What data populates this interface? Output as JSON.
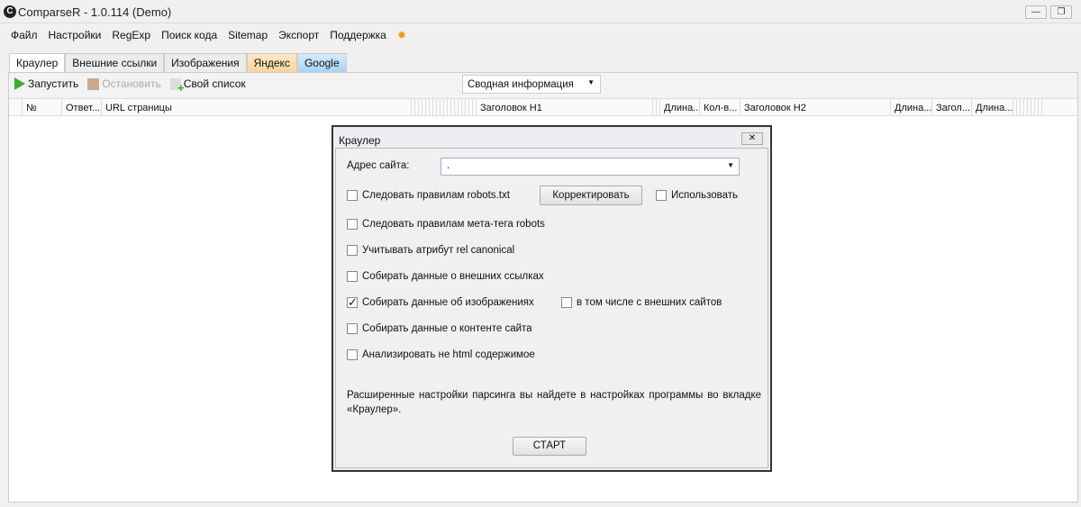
{
  "window": {
    "title": "ComparseR - 1.0.114 (Demo)",
    "logo": "C"
  },
  "menu": [
    "Файл",
    "Настройки",
    "RegExp",
    "Поиск кода",
    "Sitemap",
    "Экспорт",
    "Поддержка"
  ],
  "tabs": [
    "Краулер",
    "Внешние ссылки",
    "Изображения",
    "Яндекс",
    "Google"
  ],
  "toolbar": {
    "start": "Запустить",
    "stop": "Остановить",
    "own_list": "Свой список",
    "view_select": "Сводная информация"
  },
  "columns": [
    "№",
    "Ответ...",
    "URL страницы",
    "Заголовок H1",
    "Длина...",
    "Кол-в...",
    "Заголовок H2",
    "Длина...",
    "Загол...",
    "Длина..."
  ],
  "dialog": {
    "title": "Краулер",
    "site_label": "Адрес сайта:",
    "site_value": ".",
    "robots_txt": "Следовать правилам robots.txt",
    "correct_button": "Корректировать",
    "use": "Использовать",
    "meta_robots": "Следовать правилам мета-тега robots",
    "canonical": "Учитывать атрибут rel canonical",
    "external_links": "Собирать данные о внешних ссылках",
    "images": "Собирать данные об изображениях",
    "images_external": "в том числе с внешних сайтов",
    "content": "Собирать данные о контенте сайта",
    "non_html": "Анализировать не html содержимое",
    "note": "Расширенные настройки парсинга вы найдете в настройках программы во вкладке «Краулер».",
    "start_button": "СТАРТ",
    "images_checked": "✓"
  }
}
